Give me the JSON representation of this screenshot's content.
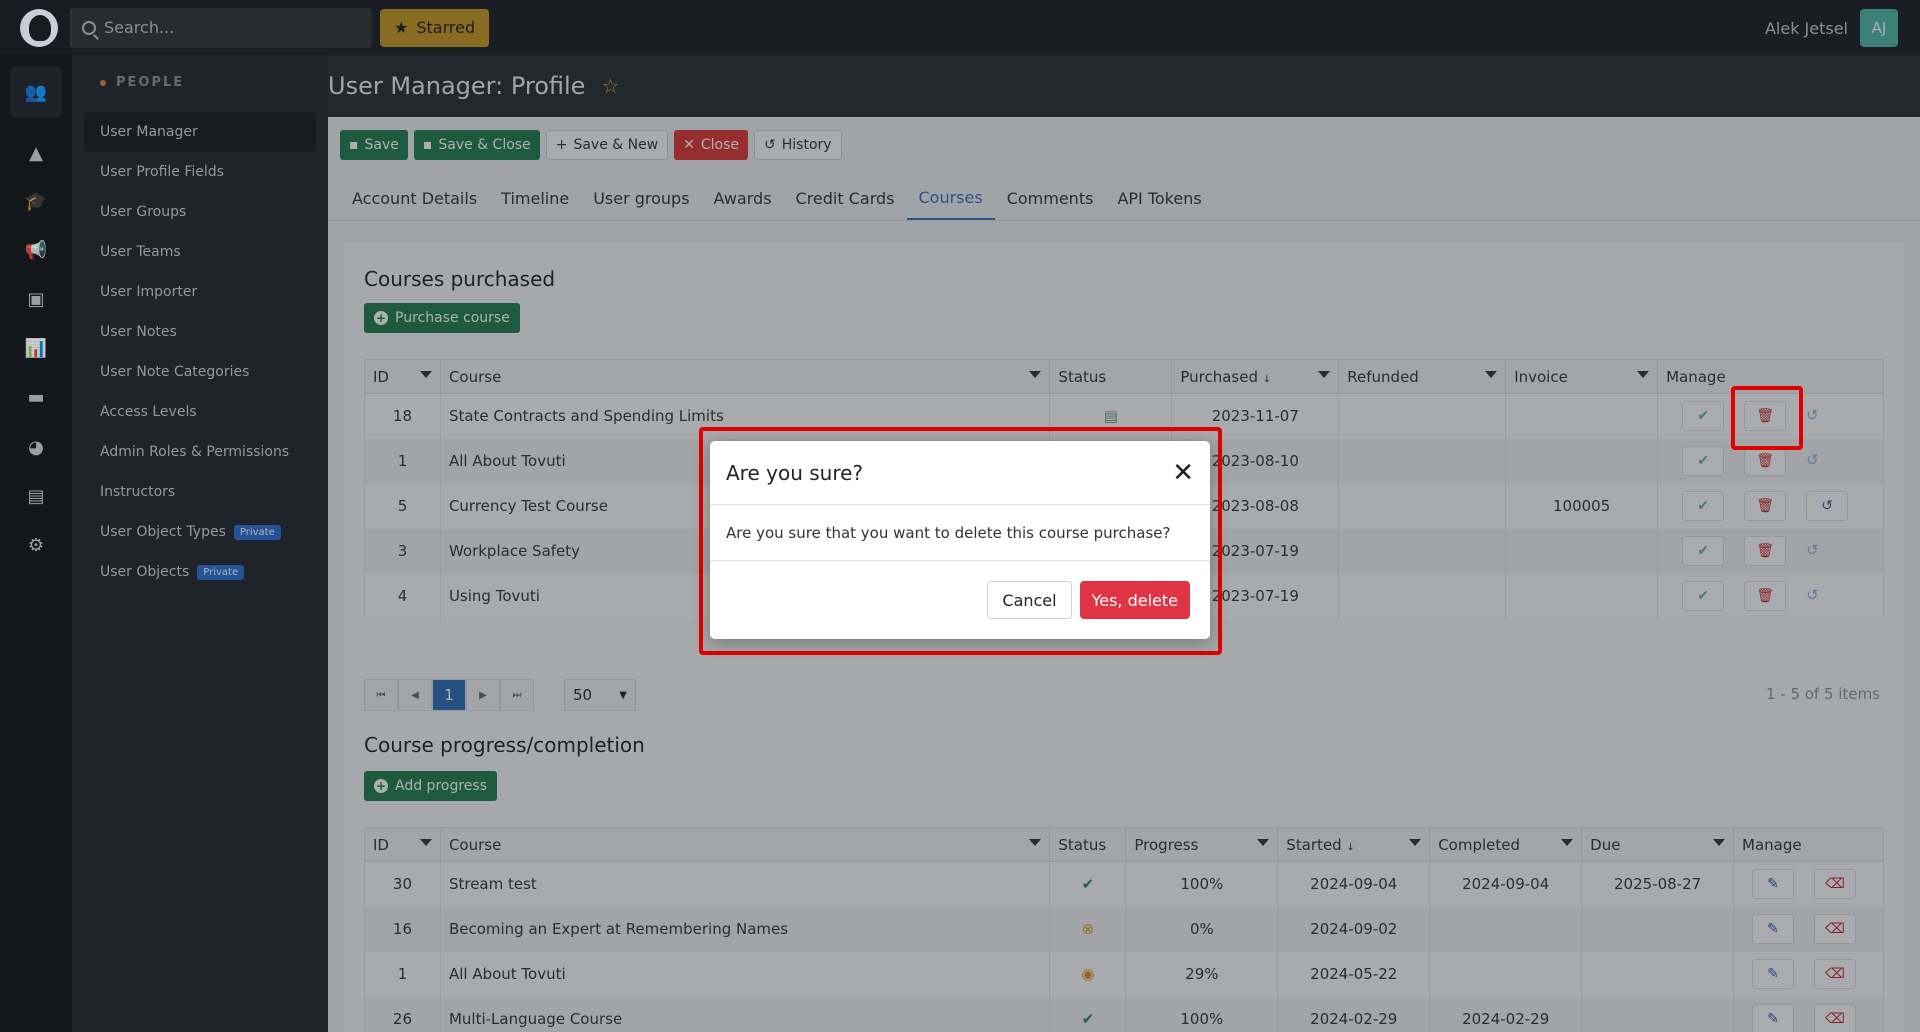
{
  "topbar": {
    "search_placeholder": "Search...",
    "starred_label": "Starred",
    "user_name": "Alek Jetsel",
    "user_initials": "AJ"
  },
  "sidenav": {
    "section": "PEOPLE",
    "items": [
      {
        "label": "User Manager",
        "active": true
      },
      {
        "label": "User Profile Fields"
      },
      {
        "label": "User Groups"
      },
      {
        "label": "User Teams"
      },
      {
        "label": "User Importer"
      },
      {
        "label": "User Notes"
      },
      {
        "label": "User Note Categories"
      },
      {
        "label": "Access Levels"
      },
      {
        "label": "Admin Roles & Permissions"
      },
      {
        "label": "Instructors"
      },
      {
        "label": "User Object Types",
        "badge": "Private"
      },
      {
        "label": "User Objects",
        "badge": "Private"
      }
    ]
  },
  "page": {
    "title": "User Manager: Profile"
  },
  "toolbar": {
    "save": "Save",
    "save_close": "Save & Close",
    "save_new": "Save & New",
    "close": "Close",
    "history": "History"
  },
  "tabs": [
    "Account Details",
    "Timeline",
    "User groups",
    "Awards",
    "Credit Cards",
    "Courses",
    "Comments",
    "API Tokens"
  ],
  "active_tab": "Courses",
  "purchased": {
    "title": "Courses purchased",
    "add_button": "Purchase course",
    "columns": [
      "ID",
      "Course",
      "Status",
      "Purchased",
      "Refunded",
      "Invoice",
      "Manage"
    ],
    "rows": [
      {
        "id": "18",
        "course": "State Contracts and Spending Limits",
        "purchased": "2023-11-07",
        "refunded": "",
        "invoice": ""
      },
      {
        "id": "1",
        "course": "All About Tovuti",
        "purchased": "2023-08-10",
        "refunded": "",
        "invoice": ""
      },
      {
        "id": "5",
        "course": "Currency Test Course",
        "purchased": "2023-08-08",
        "refunded": "",
        "invoice": "100005"
      },
      {
        "id": "3",
        "course": "Workplace Safety",
        "purchased": "2023-07-19",
        "refunded": "",
        "invoice": ""
      },
      {
        "id": "4",
        "course": "Using Tovuti",
        "purchased": "2023-07-19",
        "refunded": "",
        "invoice": ""
      }
    ],
    "pager": {
      "page": "1",
      "page_size": "50",
      "count": "1 - 5 of 5 items"
    }
  },
  "progress": {
    "title": "Course progress/completion",
    "add_button": "Add progress",
    "columns": [
      "ID",
      "Course",
      "Status",
      "Progress",
      "Started",
      "Completed",
      "Due",
      "Manage"
    ],
    "rows": [
      {
        "id": "30",
        "course": "Stream test",
        "progress": "100%",
        "started": "2024-09-04",
        "completed": "2024-09-04",
        "due": "2025-08-27"
      },
      {
        "id": "16",
        "course": "Becoming an Expert at Remembering Names",
        "progress": "0%",
        "started": "2024-09-02",
        "completed": "",
        "due": ""
      },
      {
        "id": "1",
        "course": "All About Tovuti",
        "progress": "29%",
        "started": "2024-05-22",
        "completed": "",
        "due": ""
      },
      {
        "id": "26",
        "course": "Multi-Language Course",
        "progress": "100%",
        "started": "2024-02-29",
        "completed": "2024-02-29",
        "due": ""
      }
    ]
  },
  "modal": {
    "title": "Are you sure?",
    "body": "Are you sure that you want to delete this course purchase?",
    "cancel": "Cancel",
    "confirm": "Yes, delete"
  },
  "colors": {
    "danger": "#e03444",
    "success": "#1f7a4c",
    "primary": "#3470b8",
    "highlight": "#e00000"
  }
}
